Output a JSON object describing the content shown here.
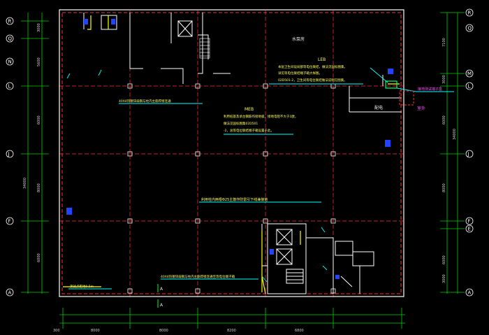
{
  "axes": {
    "left": [
      "R",
      "Q",
      "N",
      "L",
      "J",
      "F",
      "A"
    ],
    "right": [
      "R",
      "Q",
      "M",
      "L",
      "J",
      "F",
      "E",
      "A"
    ]
  },
  "dimensions": {
    "left_outer": "34000",
    "left_inner": [
      "3000",
      "5600",
      "6000",
      "8000",
      "6000"
    ],
    "right_outer": "34000",
    "right_inner": [
      "7100",
      "3000",
      "6000",
      "8000",
      "6000",
      "3000"
    ],
    "bottom": [
      "300",
      "8000",
      "8000",
      "8200",
      "6800"
    ]
  },
  "rooms": {
    "distribution": "水泵房",
    "shaft": "配电",
    "outside": "室外",
    "grounding_box": "接地测试端子盒"
  },
  "notes": {
    "led_title": "LEB",
    "led_lines": [
      "本层卫生间设局部等电位联结，做法见国标图集，",
      "详见等电位联结端子箱大样图。",
      "02D501-2，卫生间等电位联结做法说明见图集。"
    ],
    "meb_title": "MEB",
    "meb_lines": [
      "利用桩基及承台钢筋作接地极，接地电阻不大于1欧，",
      "做法见国标图集02D501",
      "-2，总等电位联结端子箱设置于此。"
    ],
    "flat_steel_1": "40X4热镀锌扁钢与柱内主筋焊接连通",
    "flat_steel_2": "40X4热镀锌扁钢与柱内主筋焊接连通至等电位端子箱",
    "column_rebar": "利用柱内两根Φ25主筋作防雷引下线兼接地",
    "test_point": "测试点距地0.5m"
  },
  "section_marks": [
    "A",
    "A"
  ],
  "colors": {
    "background": "#000000",
    "wall": "#ffffff",
    "grid_line": "#ff3333",
    "grounding": "#ffff00",
    "dimension": "#00ff00",
    "axis_circle": "#ffffff",
    "annotation": "#00ffff",
    "door": "#3366ff"
  }
}
